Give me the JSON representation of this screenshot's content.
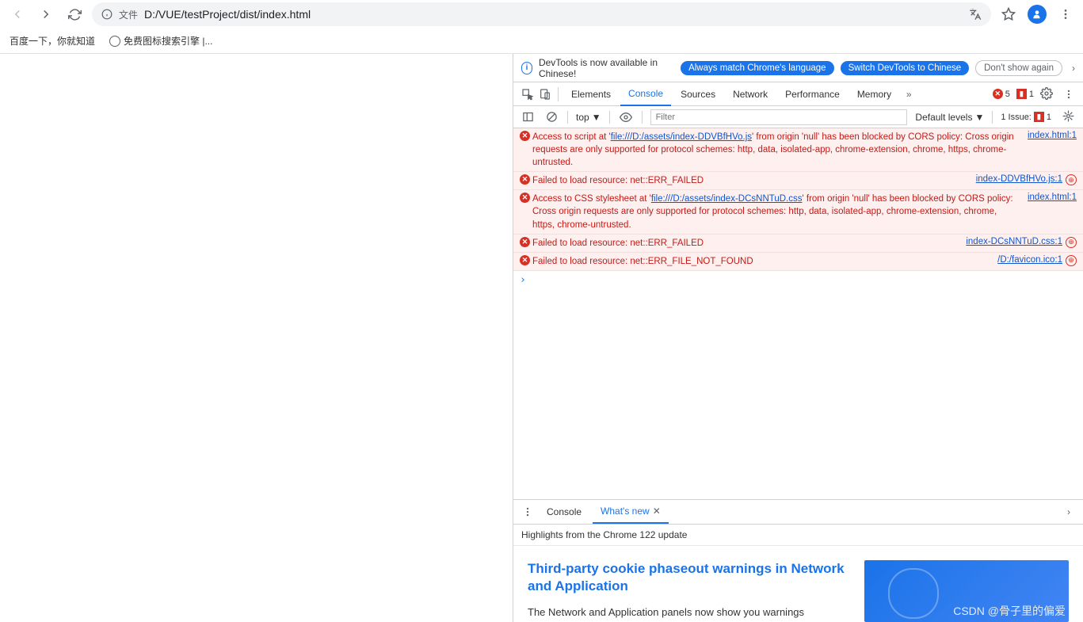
{
  "toolbar": {
    "file_label": "文件",
    "url": "D:/VUE/testProject/dist/index.html"
  },
  "bookmarks": {
    "b1": "百度一下，你就知道",
    "b2": "免费图标搜索引擎 |..."
  },
  "banner": {
    "text": "DevTools is now available in Chinese!",
    "btn1": "Always match Chrome's language",
    "btn2": "Switch DevTools to Chinese",
    "btn3": "Don't show again"
  },
  "tabs": {
    "elements": "Elements",
    "console": "Console",
    "sources": "Sources",
    "network": "Network",
    "performance": "Performance",
    "memory": "Memory"
  },
  "badges": {
    "errors": "5",
    "warns": "1"
  },
  "filter": {
    "top": "top",
    "placeholder": "Filter",
    "levels": "Default levels",
    "issues_label": "1 Issue:",
    "issues_count": "1"
  },
  "messages": [
    {
      "pre": "Access to script at '",
      "src": "file:///D:/assets/index-DDVBfHVo.js",
      "post": "' from origin 'null' has been blocked by CORS policy: Cross origin requests are only supported for protocol schemes: http, data, isolated-app, chrome-extension, chrome, https, chrome-untrusted.",
      "link": "index.html:1",
      "net": false
    },
    {
      "pre": "Failed to load resource: net::ERR_FAILED",
      "src": "",
      "post": "",
      "link": "index-DDVBfHVo.js:1",
      "net": true
    },
    {
      "pre": "Access to CSS stylesheet at '",
      "src": "file:///D:/assets/index-DCsNNTuD.css",
      "post": "' from origin 'null' has been blocked by CORS policy: Cross origin requests are only supported for protocol schemes: http, data, isolated-app, chrome-extension, chrome, https, chrome-untrusted.",
      "link": "index.html:1",
      "net": false
    },
    {
      "pre": "Failed to load resource: net::ERR_FAILED",
      "src": "",
      "post": "",
      "link": "index-DCsNNTuD.css:1",
      "net": true
    },
    {
      "pre": "Failed to load resource: net::ERR_FILE_NOT_FOUND",
      "src": "",
      "post": "",
      "link": "/D:/favicon.ico:1",
      "net": true
    }
  ],
  "drawer": {
    "console": "Console",
    "whatsnew": "What's new",
    "headline": "Highlights from the Chrome 122 update",
    "title": "Third-party cookie phaseout warnings in Network and Application",
    "desc": "The Network and Application panels now show you warnings"
  },
  "watermark": "CSDN @骨子里的偏爱"
}
